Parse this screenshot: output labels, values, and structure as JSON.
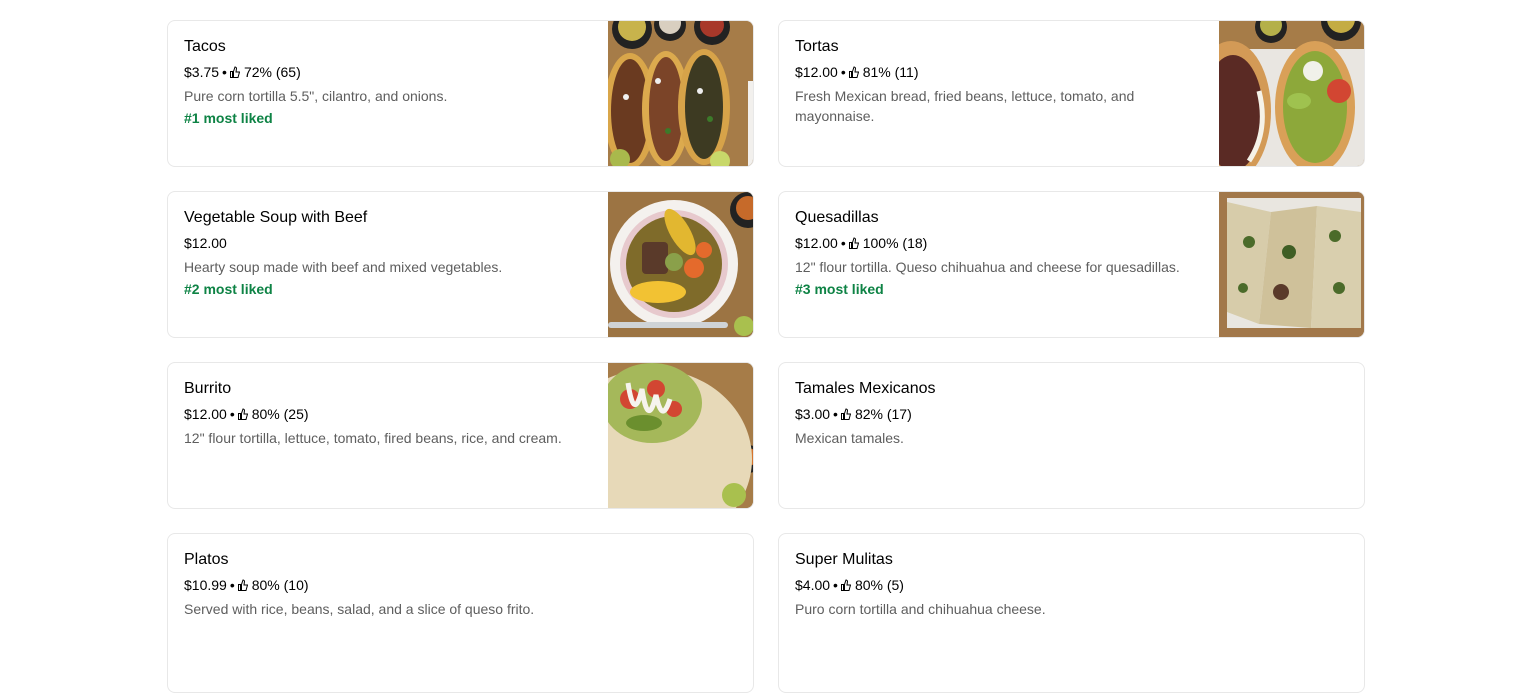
{
  "menu_items": [
    {
      "name": "Tacos",
      "price": "$3.75",
      "rating": "72% (65)",
      "description": "Pure corn tortilla 5.5\", cilantro, and onions.",
      "rank": "#1 most liked",
      "has_photo": true
    },
    {
      "name": "Tortas",
      "price": "$12.00",
      "rating": "81% (11)",
      "description": "Fresh Mexican bread, fried beans, lettuce, tomato, and mayonnaise.",
      "rank": "",
      "has_photo": true
    },
    {
      "name": "Vegetable Soup with Beef",
      "price": "$12.00",
      "rating": "",
      "description": "Hearty soup made with beef and mixed vegetables.",
      "rank": "#2 most liked",
      "has_photo": true
    },
    {
      "name": "Quesadillas",
      "price": "$12.00",
      "rating": "100% (18)",
      "description": "12\" flour tortilla. Queso chihuahua and cheese for quesadillas.",
      "rank": "#3 most liked",
      "has_photo": true
    },
    {
      "name": "Burrito",
      "price": "$12.00",
      "rating": "80% (25)",
      "description": "12\" flour tortilla, lettuce, tomato, fired beans, rice, and cream.",
      "rank": "",
      "has_photo": true
    },
    {
      "name": "Tamales Mexicanos",
      "price": "$3.00",
      "rating": "82% (17)",
      "description": "Mexican tamales.",
      "rank": "",
      "has_photo": false
    },
    {
      "name": "Platos",
      "price": "$10.99",
      "rating": "80% (10)",
      "description": "Served with rice, beans, salad, and a slice of queso frito.",
      "rank": "",
      "has_photo": false
    },
    {
      "name": "Super Mulitas",
      "price": "$4.00",
      "rating": "80% (5)",
      "description": "Puro corn tortilla and chihuahua cheese.",
      "rank": "",
      "has_photo": false
    }
  ],
  "colors": {
    "rank": "#0e8345",
    "description": "#5e5e5e",
    "border": "#e8e8e8"
  },
  "icons": {
    "rating": "thumbs-up-icon"
  }
}
